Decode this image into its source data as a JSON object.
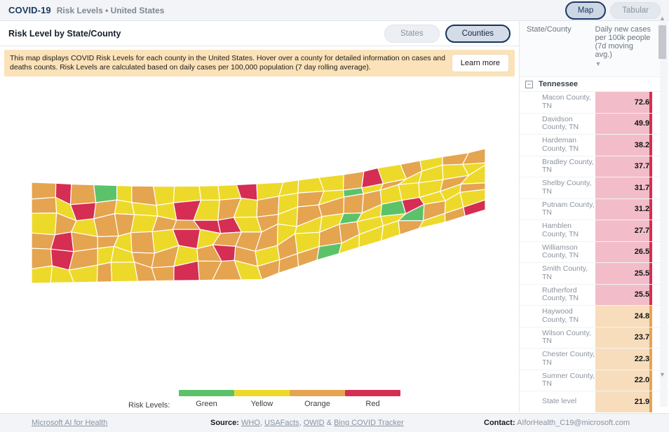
{
  "header": {
    "brand": "COVID-19",
    "subtitle": "Risk Levels • United States",
    "view_toggle": [
      {
        "label": "Map",
        "active": true
      },
      {
        "label": "Tabular",
        "active": false
      }
    ]
  },
  "subheader": {
    "title": "Risk Level by State/County",
    "scope_toggle": [
      {
        "label": "States",
        "active": false
      },
      {
        "label": "Counties",
        "active": true
      }
    ]
  },
  "banner": {
    "text": "This map displays COVID Risk Levels for each county in the United States. Hover over a county for detailed information on cases and deaths counts. Risk Levels are calculated based on daily cases per 100,000 population (7 day rolling average).",
    "button": "Learn more"
  },
  "legend": {
    "label": "Risk Levels:",
    "items": [
      {
        "name": "Green",
        "color": "#5cc26a"
      },
      {
        "name": "Yellow",
        "color": "#edd724"
      },
      {
        "name": "Orange",
        "color": "#e3a košice"
      },
      {
        "name": "Red",
        "color": "#d8234a"
      }
    ]
  },
  "risk_colors": {
    "green": "#5cc26a",
    "yellow": "#edd92a",
    "orange": "#e5a44f",
    "red": "#d62d52"
  },
  "panel": {
    "columns": [
      {
        "label": "State/County"
      },
      {
        "label": "Daily new cases per 100k people (7d moving avg.)",
        "sort": "descending",
        "sort_icon": "triangle-down-icon"
      }
    ],
    "group": {
      "name": "Tennessee",
      "collapse_icon": "minus-box-icon",
      "expanded": true
    },
    "rows": [
      {
        "name": "Macon County, TN",
        "value": "72.6",
        "level": "red"
      },
      {
        "name": "Davidson County, TN",
        "value": "49.9",
        "level": "red"
      },
      {
        "name": "Hardeman County, TN",
        "value": "38.2",
        "level": "red"
      },
      {
        "name": "Bradley County, TN",
        "value": "37.7",
        "level": "red"
      },
      {
        "name": "Shelby County, TN",
        "value": "31.7",
        "level": "red"
      },
      {
        "name": "Putnam County, TN",
        "value": "31.2",
        "level": "red"
      },
      {
        "name": "Hamblen County, TN",
        "value": "27.7",
        "level": "red"
      },
      {
        "name": "Williamson County, TN",
        "value": "26.5",
        "level": "red"
      },
      {
        "name": "Smith County, TN",
        "value": "25.5",
        "level": "red"
      },
      {
        "name": "Rutherford County, TN",
        "value": "25.5",
        "level": "red"
      },
      {
        "name": "Haywood County, TN",
        "value": "24.8",
        "level": "orange"
      },
      {
        "name": "Wilson County, TN",
        "value": "23.7",
        "level": "orange"
      },
      {
        "name": "Chester County, TN",
        "value": "22.3",
        "level": "orange"
      },
      {
        "name": "Sumner County, TN",
        "value": "22.0",
        "level": "orange"
      },
      {
        "name": "State level",
        "value": "21.9",
        "level": "orange"
      }
    ],
    "scrollbar": {
      "up_icon": "chevron-up-icon",
      "down_icon": "chevron-down-icon"
    }
  },
  "footer": {
    "org": "Microsoft AI for Health",
    "source_label": "Source:",
    "sources": [
      "WHO",
      "USAFacts",
      "OWID",
      "Bing COVID Tracker"
    ],
    "source_sep1": ", ",
    "source_sep2": " & ",
    "contact_label": "Contact:",
    "contact": "AIforHealth_C19@microsoft.com"
  },
  "map": {
    "state": "Tennessee",
    "title": "tennessee-county-risk-map"
  }
}
